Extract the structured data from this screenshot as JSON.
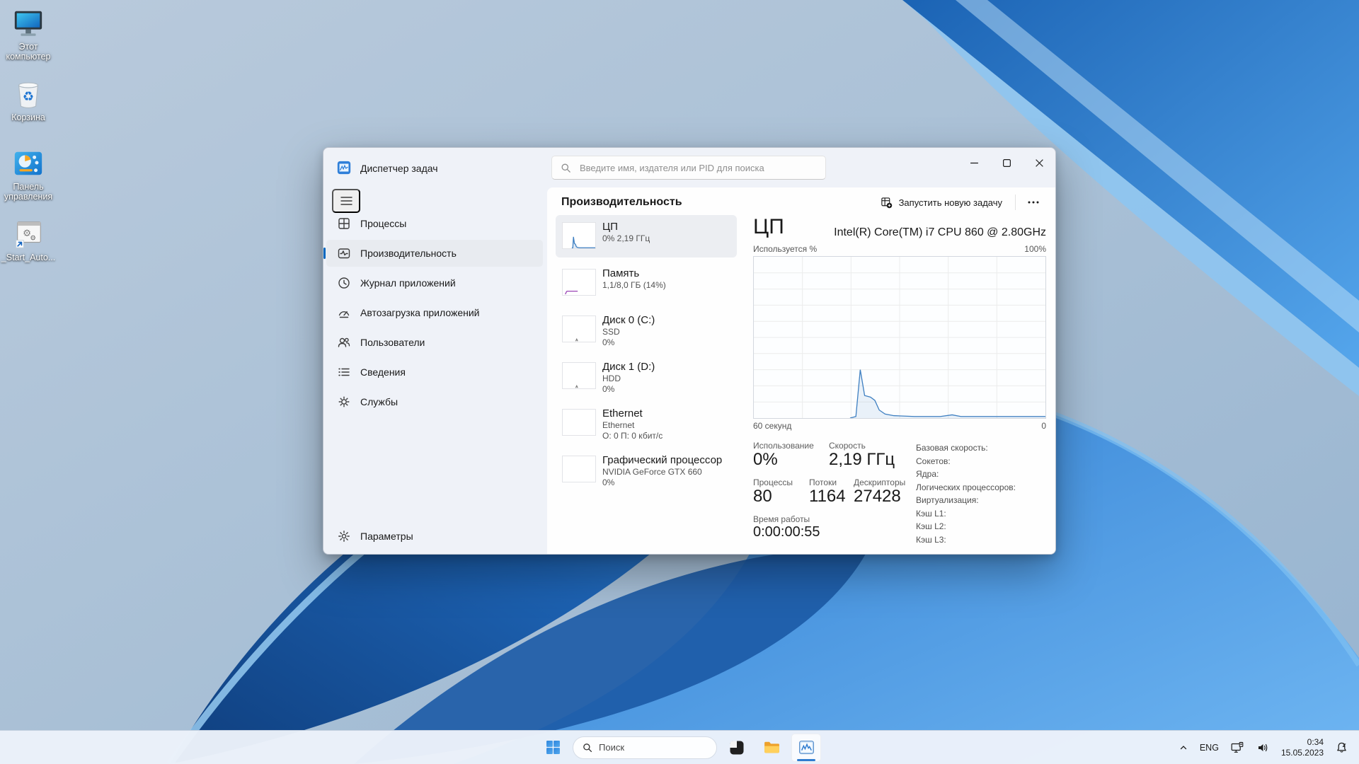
{
  "desktop": {
    "icons": [
      {
        "name": "this-pc",
        "label": "Этот компьютер"
      },
      {
        "name": "recycle-bin",
        "label": "Корзина"
      },
      {
        "name": "control-panel",
        "label": "Панель управления"
      },
      {
        "name": "start-auto-shortcut",
        "label": "_Start_Auto..."
      }
    ]
  },
  "taskmgr": {
    "title": "Диспетчер задач",
    "search_placeholder": "Введите имя, издателя или PID для поиска",
    "page_title": "Производительность",
    "toolbar": {
      "run_new_task": "Запустить новую задачу"
    },
    "sidebar": {
      "items": [
        {
          "label": "Процессы"
        },
        {
          "label": "Производительность",
          "selected": true
        },
        {
          "label": "Журнал приложений"
        },
        {
          "label": "Автозагрузка приложений"
        },
        {
          "label": "Пользователи"
        },
        {
          "label": "Сведения"
        },
        {
          "label": "Службы"
        }
      ],
      "settings_label": "Параметры"
    },
    "perf_list": [
      {
        "title": "ЦП",
        "sub1": "0% 2,19 ГГц",
        "spark": {
          "color": "#3e7fc1",
          "fill": true,
          "points": [
            [
              28,
              1
            ],
            [
              31,
              2
            ],
            [
              33,
              45
            ],
            [
              36,
              19
            ],
            [
              39,
              16
            ],
            [
              42,
              6
            ],
            [
              46,
              3
            ],
            [
              52,
              2
            ],
            [
              100,
              2
            ]
          ]
        }
      },
      {
        "title": "Память",
        "sub1": "1,1/8,0 ГБ (14%)",
        "spark": {
          "color": "#9a44b5",
          "points": [
            [
              8,
              3
            ],
            [
              12,
              14
            ],
            [
              14,
              15
            ],
            [
              46,
              15
            ]
          ]
        }
      },
      {
        "title": "Диск 0 (C:)",
        "sub1": "SSD",
        "sub2": "0%",
        "spark": {
          "color": "#7d7d7d",
          "points": [
            [
              40,
              2
            ],
            [
              43,
              10
            ],
            [
              46,
              2
            ]
          ]
        }
      },
      {
        "title": "Диск 1 (D:)",
        "sub1": "HDD",
        "sub2": "0%",
        "spark": {
          "color": "#7d7d7d",
          "points": [
            [
              40,
              2
            ],
            [
              43,
              10
            ],
            [
              46,
              2
            ]
          ]
        }
      },
      {
        "title": "Ethernet",
        "sub1": "Ethernet",
        "sub2": "О: 0 П: 0 кбит/с"
      },
      {
        "title": "Графический процессор",
        "sub1": "NVIDIA GeForce GTX 660",
        "sub2": "0%"
      }
    ],
    "cpu": {
      "stats": [
        {
          "label": "Использование",
          "value": "0%"
        },
        {
          "label": "Скорость",
          "value": "2,19 ГГц"
        },
        {
          "label": "Процессы",
          "value": "80"
        },
        {
          "label": "Потоки",
          "value": "1164"
        },
        {
          "label": "Дескрипторы",
          "value": "27428"
        },
        {
          "label": "Время работы",
          "value": "0:00:00:55"
        }
      ],
      "info_labels": [
        "Базовая скорость:",
        "Сокетов:",
        "Ядра:",
        "Логических процессоров:",
        "Виртуализация:",
        "Кэш L1:",
        "Кэш L2:",
        "Кэш L3:"
      ]
    }
  },
  "chart_data": {
    "type": "area",
    "title": "ЦП",
    "subtitle": "Intel(R) Core(TM) i7 CPU 860 @ 2.80GHz",
    "ylabel": "Используется %",
    "ymax_label": "100%",
    "x_left_label": "60 секунд",
    "x_right_label": "0",
    "ylim": [
      0,
      100
    ],
    "xlim_seconds": [
      60,
      0
    ],
    "grid": {
      "columns": 6,
      "rows": 10,
      "visible": true
    },
    "series": [
      {
        "name": "cpu_utilization_percent",
        "color": "#3e7fc1",
        "points": [
          [
            33,
            0
          ],
          [
            35,
            1
          ],
          [
            36.5,
            30
          ],
          [
            38,
            14
          ],
          [
            40,
            13
          ],
          [
            41.5,
            11
          ],
          [
            43,
            5
          ],
          [
            45,
            2.5
          ],
          [
            48,
            1.5
          ],
          [
            55,
            1
          ],
          [
            64,
            1
          ],
          [
            68,
            2
          ],
          [
            71,
            1
          ],
          [
            100,
            1
          ]
        ]
      }
    ]
  },
  "taskbar": {
    "search_label": "Поиск",
    "tray": {
      "language": "ENG",
      "time": "0:34",
      "date": "15.05.2023"
    }
  },
  "colors": {
    "accent": "#0067c0",
    "cpu_line": "#3e7fc1",
    "memory_line": "#9a44b5",
    "selection_bg": "#e8ebf0"
  }
}
